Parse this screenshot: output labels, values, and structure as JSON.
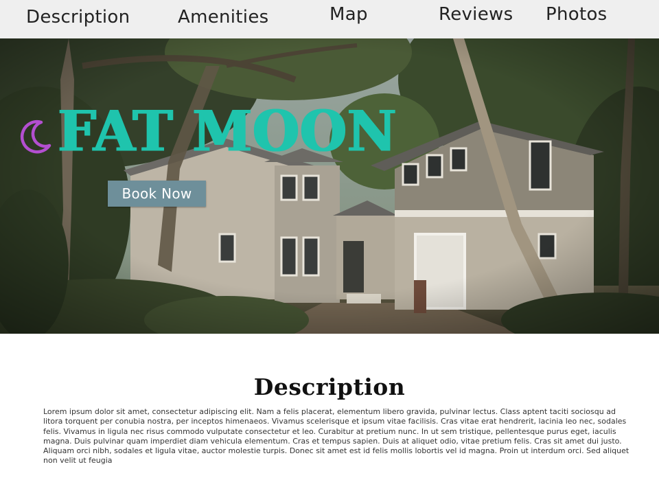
{
  "nav": {
    "items": [
      {
        "label": "Description"
      },
      {
        "label": "Amenities"
      },
      {
        "label": "Map"
      },
      {
        "label": "Reviews"
      },
      {
        "label": "Photos"
      }
    ]
  },
  "hero": {
    "brand_name": "FAT MOON",
    "book_button": "Book Now",
    "icon": "crescent-moon-icon"
  },
  "description": {
    "heading": "Description",
    "body": "Lorem ipsum dolor sit amet, consectetur adipiscing elit. Nam a felis placerat, elementum libero gravida, pulvinar lectus. Class aptent taciti sociosqu ad litora torquent per conubia nostra, per inceptos himenaeos. Vivamus scelerisque et ipsum vitae facilisis. Cras vitae erat hendrerit, lacinia leo nec, sodales felis. Vivamus in ligula nec risus commodo vulputate consectetur et leo. Curabitur at pretium nunc. In ut sem tristique, pellentesque purus eget, iaculis magna. Duis pulvinar quam imperdiet diam vehicula elementum. Cras et tempus sapien. Duis at aliquet odio, vitae pretium felis. Cras sit amet dui justo. Aliquam orci nibh, sodales et ligula vitae, auctor molestie turpis. Donec sit amet est id felis mollis lobortis vel id magna. Proin ut interdum orci. Sed aliquet non velit ut feugia"
  },
  "colors": {
    "brand": "#1fc4ad",
    "moon": "#b34fd0",
    "button": "#6e8f9a",
    "nav_bg": "#efefef"
  }
}
